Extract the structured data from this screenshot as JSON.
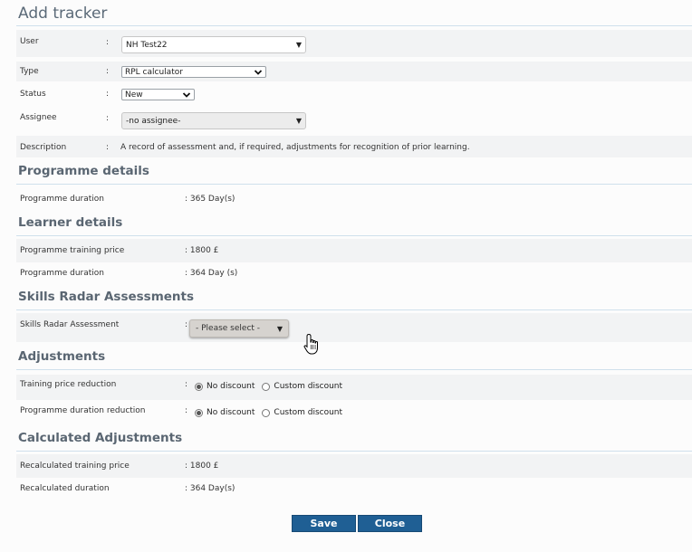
{
  "page": {
    "title": "Add tracker"
  },
  "form": {
    "user": {
      "label": "User",
      "colon": ":",
      "value": "NH Test22"
    },
    "type": {
      "label": "Type",
      "colon": ":",
      "value": "RPL calculator"
    },
    "status": {
      "label": "Status",
      "colon": ":",
      "value": "New"
    },
    "assignee": {
      "label": "Assignee",
      "colon": ":",
      "value": "-no assignee-"
    },
    "description": {
      "label": "Description",
      "colon": ":",
      "value": "A record of assessment and, if required, adjustments for recognition of prior learning."
    }
  },
  "programme_details": {
    "heading": "Programme details",
    "duration": {
      "label": "Programme duration",
      "value": ": 365 Day(s)"
    }
  },
  "learner_details": {
    "heading": "Learner details",
    "training_price": {
      "label": "Programme training price",
      "value": ": 1800 £"
    },
    "duration": {
      "label": "Programme duration",
      "value": ": 364 Day (s)"
    }
  },
  "skills_radar": {
    "heading": "Skills Radar Assessments",
    "assessment": {
      "label": "Skills Radar Assessment",
      "colon": ":",
      "value": "- Please select -"
    }
  },
  "adjustments": {
    "heading": "Adjustments",
    "training_price_reduction": {
      "label": "Training price reduction",
      "colon": ":",
      "options": [
        "No discount",
        "Custom discount"
      ],
      "selected": "No discount"
    },
    "duration_reduction": {
      "label": "Programme duration reduction",
      "colon": ":",
      "options": [
        "No discount",
        "Custom discount"
      ],
      "selected": "No discount"
    }
  },
  "calculated": {
    "heading": "Calculated Adjustments",
    "training_price": {
      "label": "Recalculated training price",
      "value": ": 1800 £"
    },
    "duration": {
      "label": "Recalculated duration",
      "value": ": 364 Day(s)"
    }
  },
  "buttons": {
    "save": "Save",
    "close": "Close"
  },
  "colors": {
    "button": "#1f5f94",
    "heading": "#5a6672",
    "divider": "#cfe0ec"
  },
  "icons": {
    "dropdown": "triangle-down-icon",
    "chevron": "chevron-down-icon",
    "cursor": "hand-pointer-icon"
  }
}
